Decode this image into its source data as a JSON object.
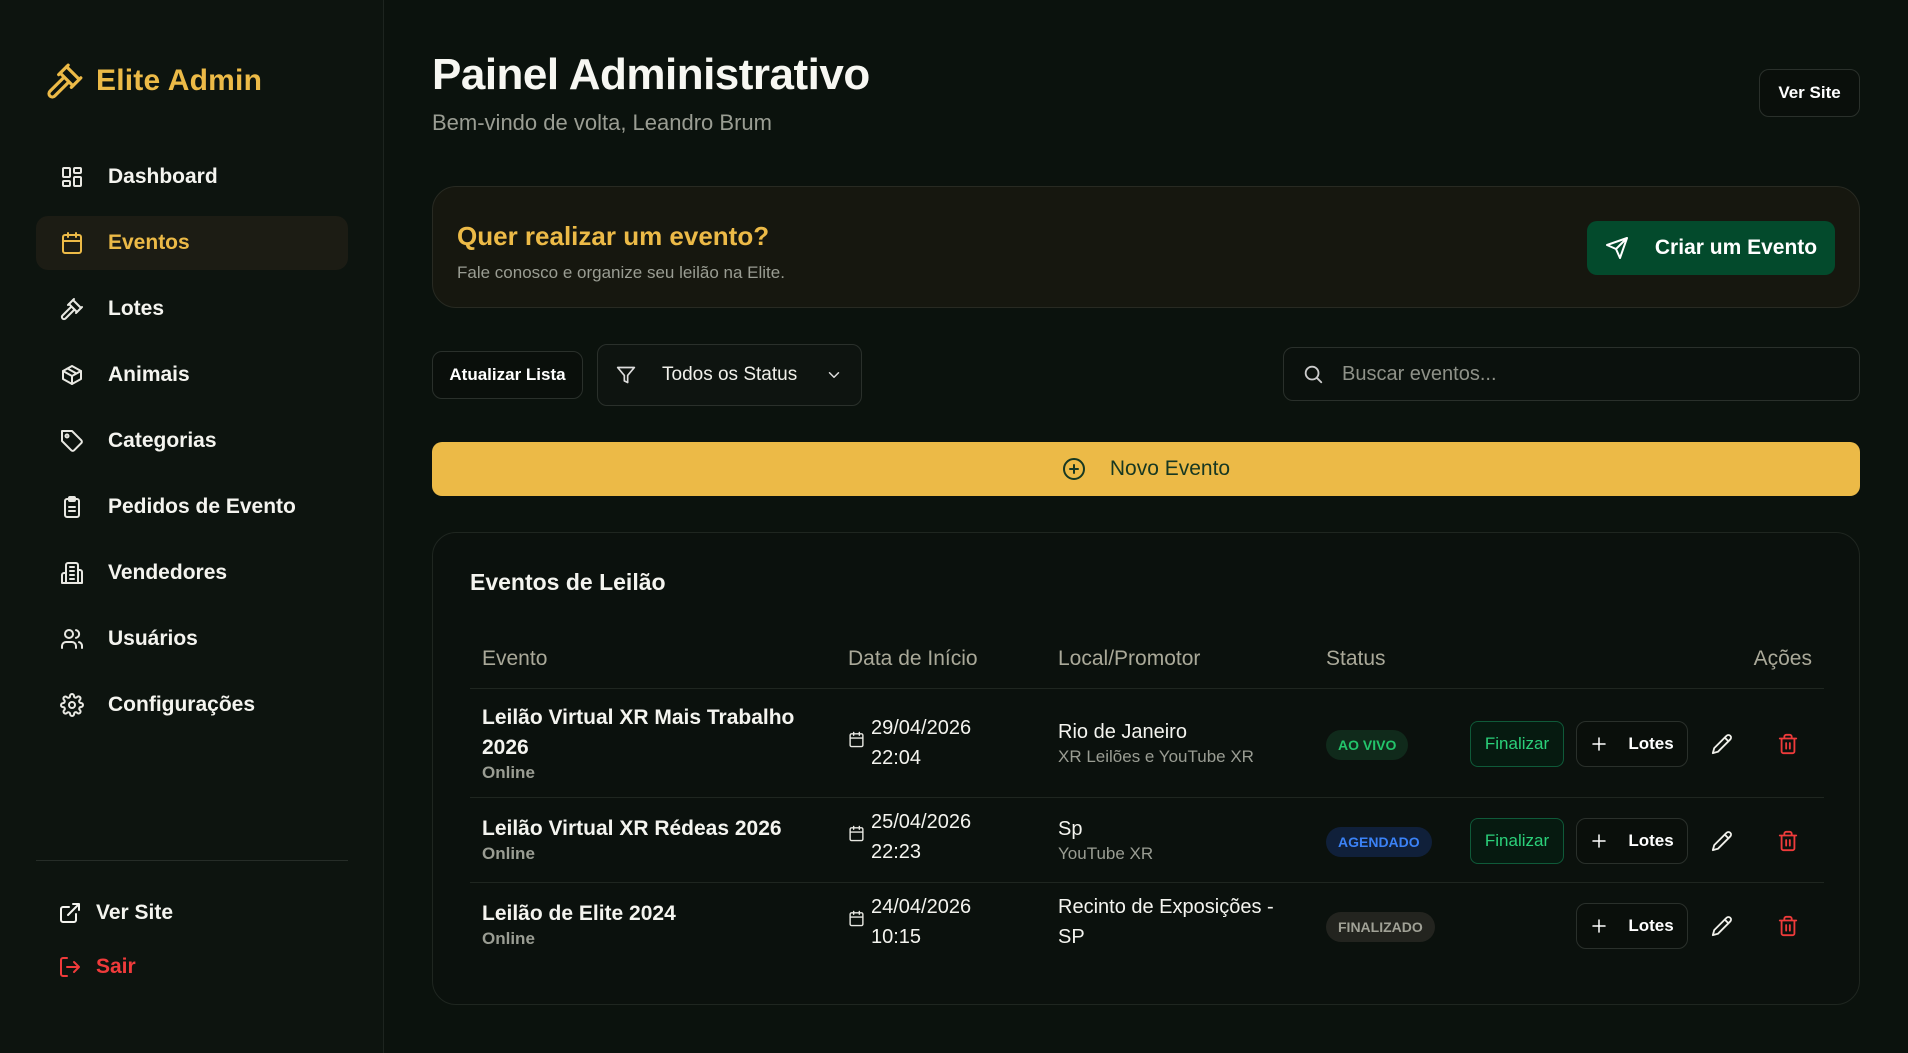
{
  "brand": {
    "name": "Elite Admin",
    "icon": "gavel-icon"
  },
  "sidebar": {
    "items": [
      {
        "label": "Dashboard",
        "icon": "dashboard-icon"
      },
      {
        "label": "Eventos",
        "icon": "calendar-icon",
        "active": true
      },
      {
        "label": "Lotes",
        "icon": "gavel-icon"
      },
      {
        "label": "Animais",
        "icon": "box-icon"
      },
      {
        "label": "Categorias",
        "icon": "tag-icon"
      },
      {
        "label": "Pedidos de Evento",
        "icon": "clipboard-icon"
      },
      {
        "label": "Vendedores",
        "icon": "building-icon"
      },
      {
        "label": "Usuários",
        "icon": "users-icon"
      },
      {
        "label": "Configurações",
        "icon": "gear-icon"
      }
    ],
    "ver_site": "Ver Site",
    "logout": "Sair"
  },
  "header": {
    "title": "Painel Administrativo",
    "subtitle": "Bem-vindo de volta, Leandro Brum",
    "ver_site": "Ver Site"
  },
  "promo": {
    "title": "Quer realizar um evento?",
    "text": "Fale conosco e organize seu leilão na Elite.",
    "button": "Criar um Evento"
  },
  "toolbar": {
    "refresh": "Atualizar Lista",
    "status_filter": "Todos os Status",
    "search_placeholder": "Buscar eventos..."
  },
  "new_event_button": "Novo Evento",
  "table": {
    "title": "Eventos de Leilão",
    "columns": [
      "Evento",
      "Data de Início",
      "Local/Promotor",
      "Status",
      "Ações"
    ],
    "rows": [
      {
        "name": "Leilão Virtual XR Mais Trabalho 2026",
        "type": "Online",
        "date": "29/04/2026",
        "time": "22:04",
        "local": "Rio de Janeiro",
        "promoter": "XR Leilões e YouTube XR",
        "status": "AO VIVO",
        "finalize": "Finalizar",
        "lotes": "Lotes"
      },
      {
        "name": "Leilão Virtual XR Rédeas 2026",
        "type": "Online",
        "date": "25/04/2026",
        "time": "22:23",
        "local": "Sp",
        "promoter": "YouTube XR",
        "status": "AGENDADO",
        "finalize": "Finalizar",
        "lotes": "Lotes"
      },
      {
        "name": "Leilão de Elite 2024",
        "type": "Online",
        "date": "24/04/2026",
        "time": "10:15",
        "local": "Recinto de Exposições - SP",
        "promoter": "",
        "status": "FINALIZADO",
        "lotes": "Lotes"
      }
    ]
  },
  "colors": {
    "accent": "#ecba47",
    "primary_green": "#034a2c",
    "danger": "#ef3b3b",
    "background": "#0b120d"
  }
}
